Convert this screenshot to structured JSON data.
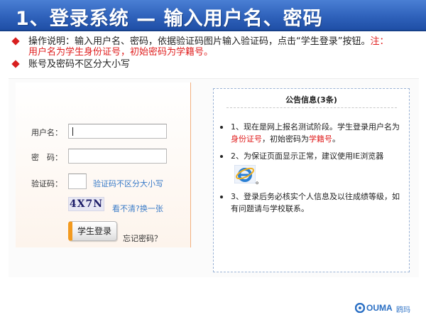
{
  "slide": {
    "title": "1、登录系统 — 输入用户名、密码",
    "bullets": [
      {
        "text": "操作说明：输入用户名、密码，依据验证码图片输入验证码，点击“学生登录”按钮。",
        "note": "注：用户名为学生身份证号，初始密码为学籍号。"
      },
      {
        "text": "账号及密码不区分大小写"
      }
    ]
  },
  "login": {
    "username_label": "用户名：",
    "username_value": "",
    "password_label": "密　码：",
    "password_value": "",
    "captcha_label": "验证码：",
    "captcha_value": "",
    "captcha_hint": "验证码不区分大小写",
    "captcha_image_text": "4X7N",
    "refresh_link": "看不清?换一张",
    "login_button": "学生登录",
    "forgot_link": "忘记密码？"
  },
  "notice": {
    "title": "公告信息(3条)",
    "items": [
      {
        "prefix": "1、现在是网上报名测试阶段。学生登录用户名为",
        "hl1": "身份证号",
        "mid": "，初始密码为",
        "hl2": "学籍号",
        "suffix": "。"
      },
      {
        "text": "2、为保证页面显示正常，建议使用IE浏览器"
      },
      {
        "text": "3、登录后务必核实个人信息及以往成绩等级，如有问题请与学校联系。"
      }
    ],
    "ie_period": "。"
  },
  "logo": {
    "text": "OUMA",
    "cn": "鸥玛"
  },
  "colors": {
    "title_bar": "#2f62bb",
    "bullet": "#d81e1e",
    "highlight": "#e02020",
    "link": "#3a7bc8",
    "button_accent": "#f39a1e",
    "panel_border": "#f2b080"
  }
}
